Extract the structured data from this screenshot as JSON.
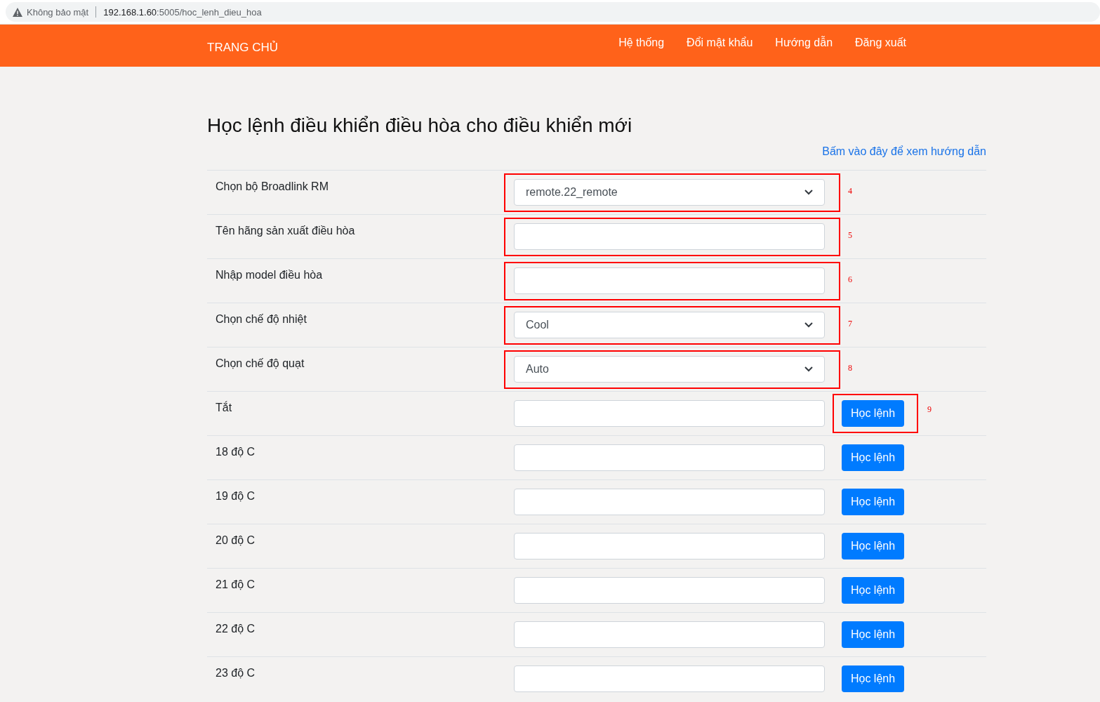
{
  "browser": {
    "security": "Không bảo mật",
    "url_host": "192.168.1.60",
    "url_path": ":5005/hoc_lenh_dieu_hoa"
  },
  "navbar": {
    "brand": "TRANG CHỦ",
    "links": [
      "Hệ thống",
      "Đổi mật khẩu",
      "Hướng dẫn",
      "Đăng xuất"
    ]
  },
  "title": "Học lệnh điều khiển điều hòa cho điều khiển mới",
  "help_link": "Bấm vào đây để xem hướng dẫn",
  "rows": [
    {
      "kind": "select",
      "label": "Chọn bộ Broadlink RM",
      "value": "remote.22_remote",
      "callout": "4"
    },
    {
      "kind": "text",
      "label": "Tên hãng sản xuất điều hòa",
      "callout": "5"
    },
    {
      "kind": "text",
      "label": "Nhập model điều hòa",
      "callout": "6"
    },
    {
      "kind": "select",
      "label": "Chọn chế độ nhiệt",
      "value": "Cool",
      "callout": "7"
    },
    {
      "kind": "select",
      "label": "Chọn chế độ quạt",
      "value": "Auto",
      "callout": "8"
    },
    {
      "kind": "learn",
      "label": "Tắt",
      "button": "Học lệnh",
      "callout": "9"
    },
    {
      "kind": "learn",
      "label": "18 độ C",
      "button": "Học lệnh"
    },
    {
      "kind": "learn",
      "label": "19 độ C",
      "button": "Học lệnh"
    },
    {
      "kind": "learn",
      "label": "20 độ C",
      "button": "Học lệnh"
    },
    {
      "kind": "learn",
      "label": "21 độ C",
      "button": "Học lệnh"
    },
    {
      "kind": "learn",
      "label": "22 độ C",
      "button": "Học lệnh"
    },
    {
      "kind": "learn",
      "label": "23 độ C",
      "button": "Học lệnh"
    }
  ]
}
